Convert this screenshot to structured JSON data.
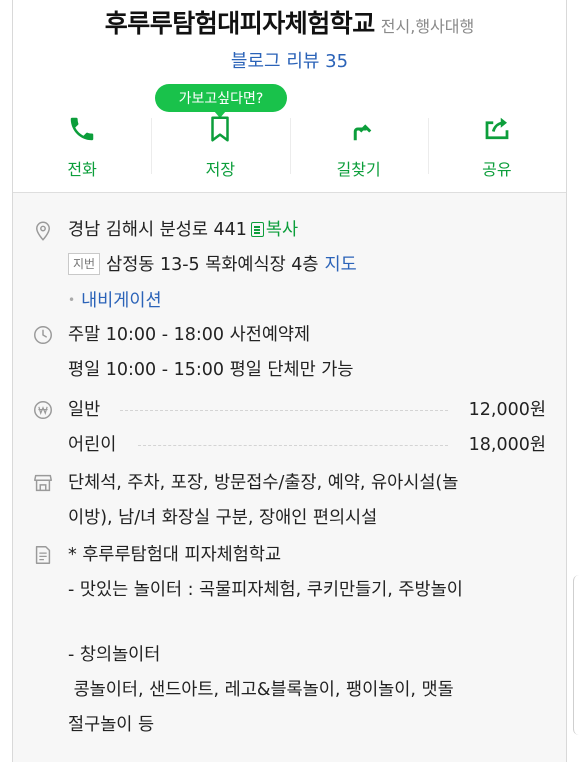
{
  "place": {
    "title": "후루루탐험대피자체험학교",
    "category": "전시,행사대행",
    "review_link": "블로그 리뷰 35"
  },
  "tooltip": "가보고싶다면?",
  "actions": [
    {
      "label": "전화",
      "icon": "phone-icon"
    },
    {
      "label": "저장",
      "icon": "bookmark-icon"
    },
    {
      "label": "길찾기",
      "icon": "directions-icon"
    },
    {
      "label": "공유",
      "icon": "share-icon"
    }
  ],
  "address": {
    "road": "경남 김해시 분성로 441",
    "copy_label": "복사",
    "jibun_tag": "지번",
    "jibun": "삼정동 13-5 목화예식장 4층",
    "map_label": "지도",
    "navigation": "내비게이션"
  },
  "hours": {
    "line1": "주말 10:00 - 18:00 사전예약제",
    "line2": "평일 10:00 - 15:00 평일 단체만 가능"
  },
  "prices": [
    {
      "label": "일반",
      "value": "12,000원"
    },
    {
      "label": "어린이",
      "value": "18,000원"
    }
  ],
  "facilities": {
    "line1": "단체석, 주차, 포장, 방문접수/출장, 예약, 유아시설(놀",
    "line2": "이방), 남/녀 화장실 구분, 장애인 편의시설"
  },
  "description": {
    "line1": "*  후루루탐험대 피자체험학교",
    "line2": "- 맛있는 놀이터 : 곡물피자체험, 쿠키만들기, 주방놀이",
    "line3": "- 창의놀이터",
    "line4": " 콩놀이터, 샌드아트, 레고&블록놀이, 팽이놀이, 맷돌",
    "line5": "절구놀이 등"
  },
  "colors": {
    "accent_green": "#0c9e3b",
    "tooltip_green": "#19c24b",
    "link_blue": "#2b63b8",
    "info_background": "#f7f7f7"
  }
}
